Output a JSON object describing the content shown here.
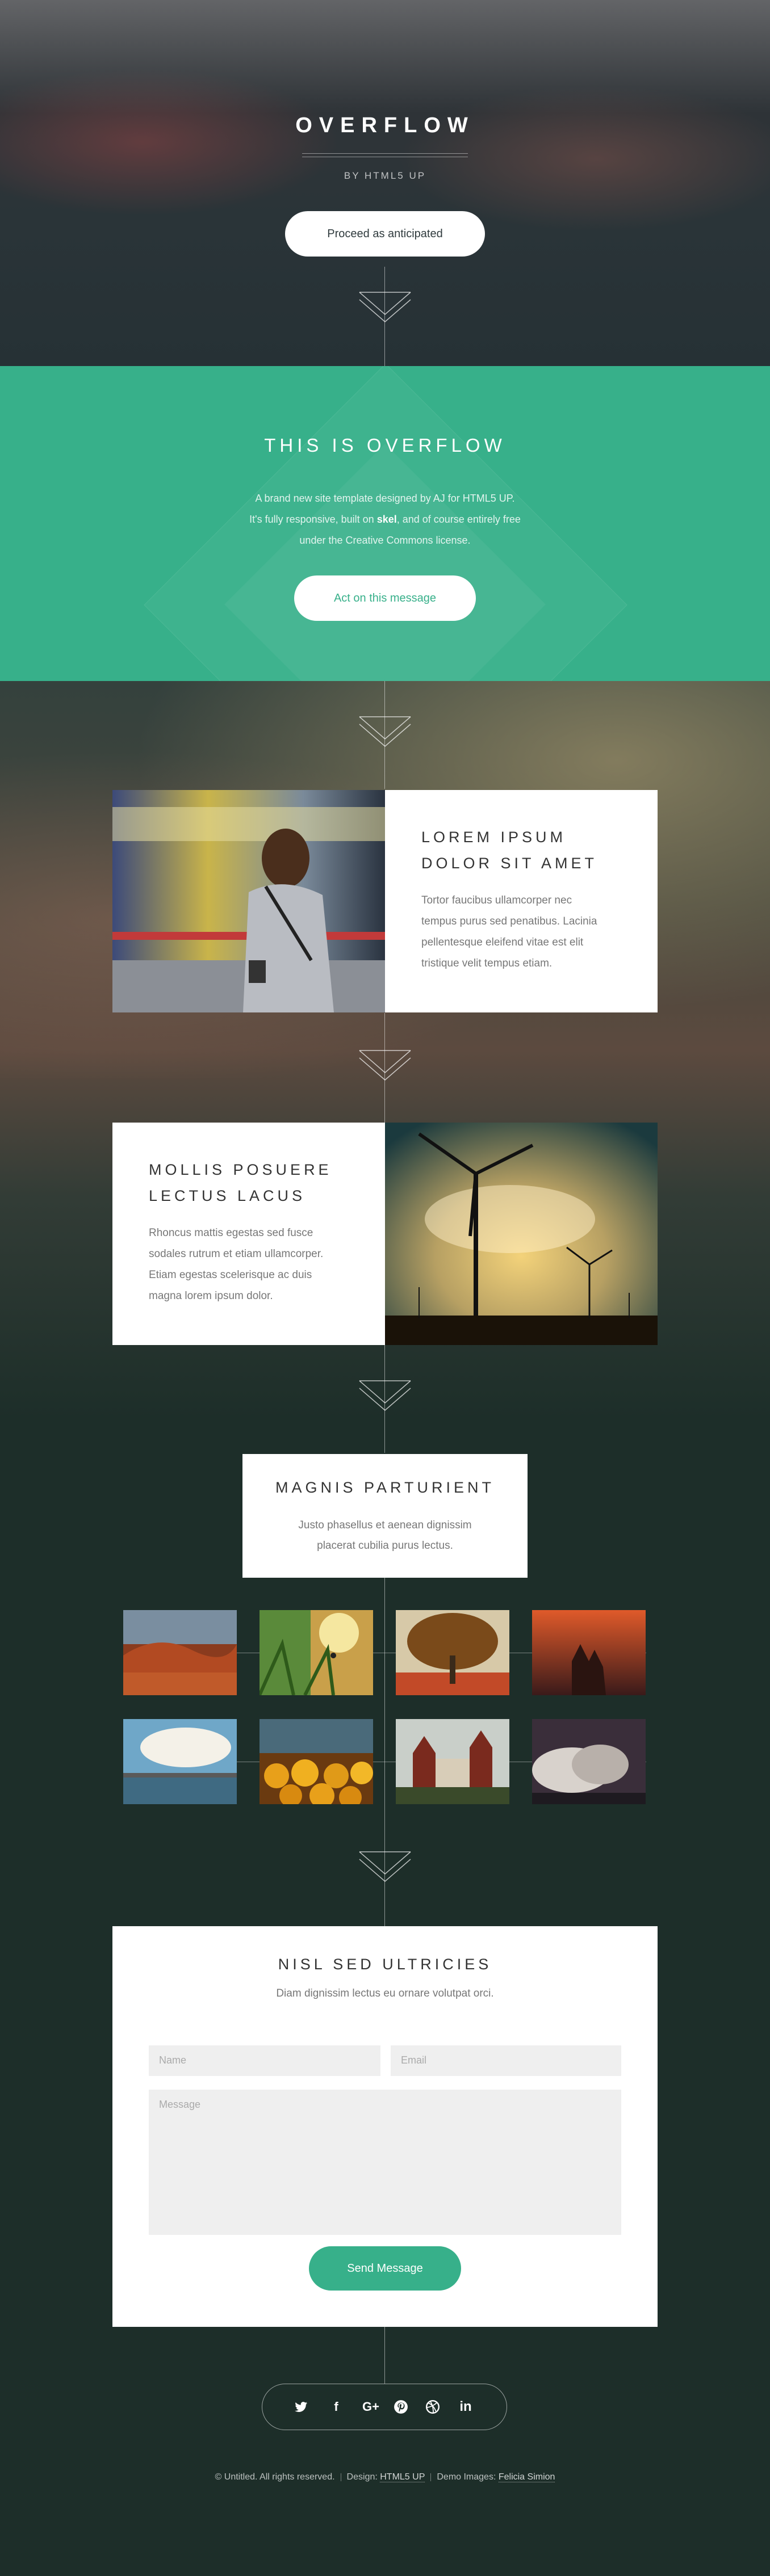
{
  "header": {
    "title": "OVERFLOW",
    "byline": "BY HTML5 UP",
    "button_label": "Proceed as anticipated"
  },
  "intro": {
    "title": "THIS IS OVERFLOW",
    "line1": "A brand new site template designed by AJ for HTML5 UP.",
    "line2_pre": "It's fully responsive, built on ",
    "line2_bold": "skel",
    "line2_post": ", and of course entirely free",
    "line3": "under the Creative Commons license.",
    "button_label": "Act on this message"
  },
  "feature1": {
    "title_line1": "LOREM IPSUM",
    "title_line2": "DOLOR SIT AMET",
    "text": [
      "Tortor faucibus ullamcorper nec",
      "tempus purus sed penatibus. Lacinia",
      "pellentesque eleifend vitae est elit",
      "tristique velit tempus etiam."
    ]
  },
  "feature2": {
    "title_line1": "MOLLIS POSUERE",
    "title_line2": "LECTUS LACUS",
    "text": [
      "Rhoncus mattis egestas sed fusce",
      "sodales rutrum et etiam ullamcorper.",
      "Etiam egestas scelerisque ac duis",
      "magna lorem ipsum dolor."
    ]
  },
  "gallery": {
    "title": "MAGNIS PARTURIENT",
    "text_line1": "Justo phasellus et aenean dignissim",
    "text_line2": "placerat cubilia purus lectus."
  },
  "contact": {
    "title": "NISL SED ULTRICIES",
    "subtitle": "Diam dignissim lectus eu ornare volutpat orci.",
    "name_placeholder": "Name",
    "email_placeholder": "Email",
    "message_placeholder": "Message",
    "button_label": "Send Message"
  },
  "social": [
    "twitter-icon",
    "facebook-icon",
    "google-plus-icon",
    "pinterest-icon",
    "dribbble-icon",
    "linkedin-icon"
  ],
  "footer": {
    "copyright": "© Untitled. All rights reserved.",
    "design_label": "Design: ",
    "design_link": "HTML5 UP",
    "images_label": "Demo Images: ",
    "images_link": "Felicia Simion"
  },
  "colors": {
    "accent": "#37b08a",
    "dark_bg": "#1d2e29"
  }
}
